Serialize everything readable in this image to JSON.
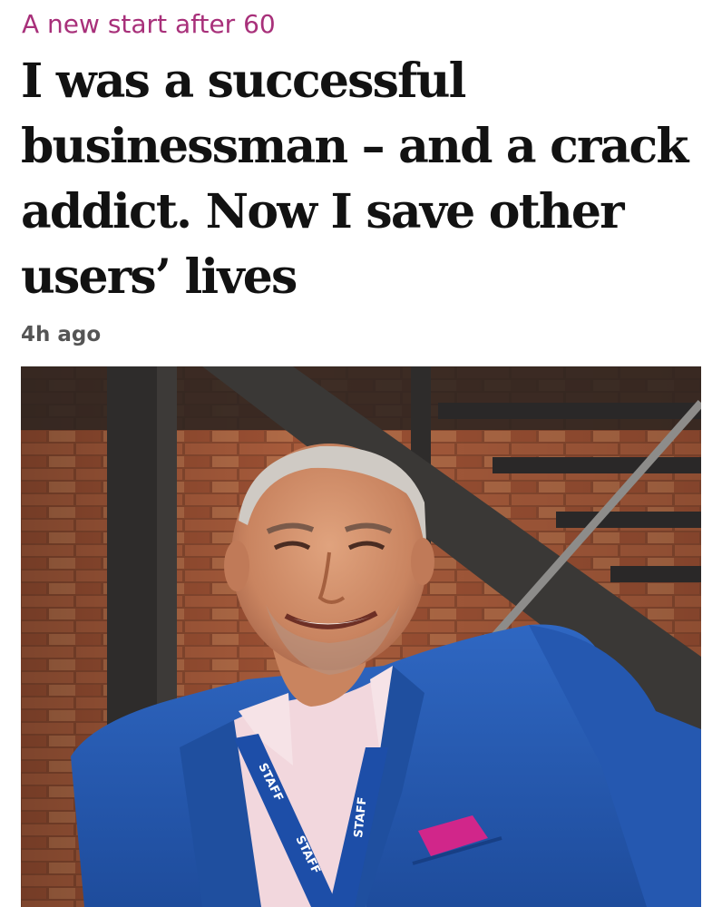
{
  "article": {
    "kicker": "A new start after 60",
    "headline": "I was a successful businessman – and a crack addict. Now I save other users’ lives",
    "timestamp": "4h ago",
    "image": {
      "lanyard_text": "STAFF"
    }
  },
  "colors": {
    "kicker": "#a8307a",
    "headline": "#121212",
    "timestamp": "#555555",
    "background": "#ffffff"
  }
}
